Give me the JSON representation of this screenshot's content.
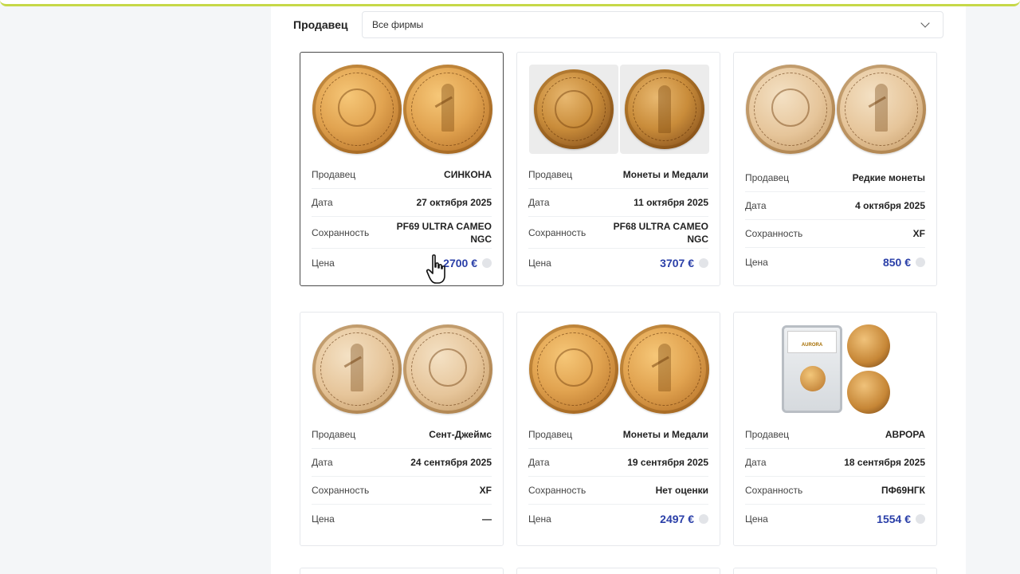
{
  "filter": {
    "label": "Продавец",
    "selected": "Все фирмы"
  },
  "labels": {
    "seller": "Продавец",
    "date": "Дата",
    "grade": "Сохранность",
    "price": "Цена"
  },
  "cards": [
    {
      "seller": "СИНКОНА",
      "date": "27 октября 2025",
      "grade": "PF69 ULTRA CAMEO NGC",
      "price": "2700 €",
      "active": true
    },
    {
      "seller": "Монеты и Медали",
      "date": "11 октября 2025",
      "grade": "PF68 ULTRA CAMEO NGC",
      "price": "3707 €"
    },
    {
      "seller": "Редкие монеты",
      "date": "4 октября 2025",
      "grade": "XF",
      "price": "850 €"
    },
    {
      "seller": "Сент-Джеймс",
      "date": "24 сентября 2025",
      "grade": "XF",
      "price": "—"
    },
    {
      "seller": "Монеты и Медали",
      "date": "19 сентября 2025",
      "grade": "Нет оценки",
      "price": "2497 €"
    },
    {
      "seller": "АВРОРА",
      "date": "18 сентября 2025",
      "grade": "ПФ69НГК",
      "price": "1554 €"
    }
  ],
  "slab_label": "AURORA",
  "colors": {
    "price": "#2a3fa8",
    "accent_strip": "#c6d848",
    "active_border": "#4a4a4a"
  },
  "icons": [
    "chevron-down-icon",
    "info-icon",
    "hand-cursor-icon"
  ]
}
